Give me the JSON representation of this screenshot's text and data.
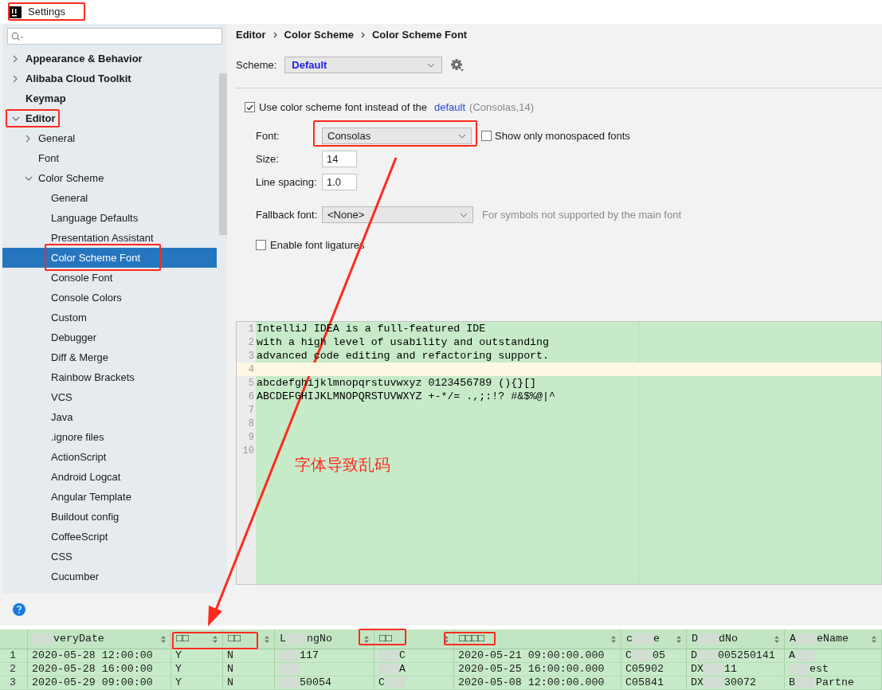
{
  "window": {
    "title": "Settings"
  },
  "tree": [
    {
      "label": "Appearance & Behavior",
      "expanded": false,
      "selected": false
    },
    {
      "label": "Alibaba Cloud Toolkit",
      "expanded": false,
      "selected": false
    },
    {
      "label": "Keymap",
      "selected": false
    },
    {
      "label": "Editor",
      "expanded": true,
      "selected": false,
      "children": [
        {
          "label": "General",
          "expanded": false,
          "selected": false
        },
        {
          "label": "Font",
          "selected": false
        },
        {
          "label": "Color Scheme",
          "expanded": true,
          "selected": false,
          "children": [
            {
              "label": "General",
              "selected": false
            },
            {
              "label": "Language Defaults",
              "selected": false
            },
            {
              "label": "Presentation Assistant",
              "selected": false
            },
            {
              "label": "Color Scheme Font",
              "selected": true
            },
            {
              "label": "Console Font",
              "selected": false
            },
            {
              "label": "Console Colors",
              "selected": false
            },
            {
              "label": "Custom",
              "selected": false
            },
            {
              "label": "Debugger",
              "selected": false
            },
            {
              "label": "Diff & Merge",
              "selected": false
            },
            {
              "label": "Rainbow Brackets",
              "selected": false
            },
            {
              "label": "VCS",
              "selected": false
            },
            {
              "label": "Java",
              "selected": false
            },
            {
              "label": ".ignore files",
              "selected": false
            },
            {
              "label": "ActionScript",
              "selected": false
            },
            {
              "label": "Android Logcat",
              "selected": false
            },
            {
              "label": "Angular Template",
              "selected": false
            },
            {
              "label": "Buildout config",
              "selected": false
            },
            {
              "label": "CoffeeScript",
              "selected": false
            },
            {
              "label": "CSS",
              "selected": false
            },
            {
              "label": "Cucumber",
              "selected": false
            }
          ]
        }
      ]
    }
  ],
  "breadcrumb": [
    "Editor",
    "Color Scheme",
    "Color Scheme Font"
  ],
  "scheme": {
    "label": "Scheme:",
    "value": "Default"
  },
  "use_scheme_font": {
    "checked": true,
    "label": "Use color scheme font instead of the",
    "link": "default",
    "hint": "(Consolas,14)"
  },
  "font": {
    "label": "Font:",
    "value": "Consolas"
  },
  "show_monospaced": {
    "checked": false,
    "label": "Show only monospaced fonts"
  },
  "size": {
    "label": "Size:",
    "value": "14"
  },
  "line_spacing": {
    "label": "Line spacing:",
    "value": "1.0"
  },
  "fallback_font": {
    "label": "Fallback font:",
    "value": "<None>",
    "hint": "For symbols not supported by the main font"
  },
  "ligatures": {
    "checked": false,
    "label": "Enable font ligatures"
  },
  "preview": {
    "lines": [
      {
        "number": "1",
        "text": "IntelliJ IDEA is a full-featured IDE",
        "current": false
      },
      {
        "number": "2",
        "text": "with a high level of usability and outstanding",
        "current": false
      },
      {
        "number": "3",
        "text": "advanced code editing and refactoring support.",
        "current": false
      },
      {
        "number": "4",
        "current": true
      },
      {
        "number": "5",
        "text": "abcdefghijklmnopqrstuvwxyz 0123456789 (){}[]",
        "current": false
      },
      {
        "number": "6",
        "text": "ABCDEFGHIJKLMNOPQRSTUVWXYZ +-*/= .,;:!? #&$%@|^",
        "current": false
      },
      {
        "number": "7",
        "current": false
      },
      {
        "number": "8",
        "current": false
      },
      {
        "number": "9",
        "current": false
      },
      {
        "number": "10",
        "current": false
      }
    ]
  },
  "annotation": {
    "text": "字体导致乱码"
  },
  "table": {
    "columns": [
      null,
      [
        null,
        "veryDate"
      ],
      [
        "□□"
      ],
      [
        "□□"
      ],
      [
        "L",
        null,
        "ngNo"
      ],
      [
        "□□"
      ],
      [
        "□□□□"
      ],
      [
        "c",
        null,
        "e"
      ],
      [
        "D",
        null,
        "dNo"
      ],
      [
        "A",
        null,
        "eName"
      ]
    ],
    "rows": [
      {
        "cells": [
          [
            "1"
          ],
          [
            "2020-05-28 12:00:00"
          ],
          [
            "Y"
          ],
          [
            "N"
          ],
          [
            null,
            "117"
          ],
          [
            null,
            "C"
          ],
          [
            "2020-05-21 09:00:00.000"
          ],
          [
            "C",
            null,
            "05"
          ],
          [
            "D",
            null,
            "005250141"
          ],
          [
            "A",
            null
          ]
        ]
      },
      {
        "cells": [
          [
            "2"
          ],
          [
            "2020-05-28 16:00:00"
          ],
          [
            "Y"
          ],
          [
            "N"
          ],
          [
            null
          ],
          [
            null,
            "A"
          ],
          [
            "2020-05-25 16:00:00.000"
          ],
          [
            "C05902"
          ],
          [
            "DX",
            null,
            "11"
          ],
          [
            null,
            "est"
          ]
        ]
      },
      {
        "cells": [
          [
            "3"
          ],
          [
            "2020-05-29 09:00:00"
          ],
          [
            "Y"
          ],
          [
            "N"
          ],
          [
            null,
            "50054"
          ],
          [
            "C",
            null
          ],
          [
            "2020-05-08 12:00:00.000"
          ],
          [
            "C05841"
          ],
          [
            "DX",
            null,
            "30072"
          ],
          [
            "B",
            null,
            "Partne"
          ]
        ]
      }
    ]
  }
}
